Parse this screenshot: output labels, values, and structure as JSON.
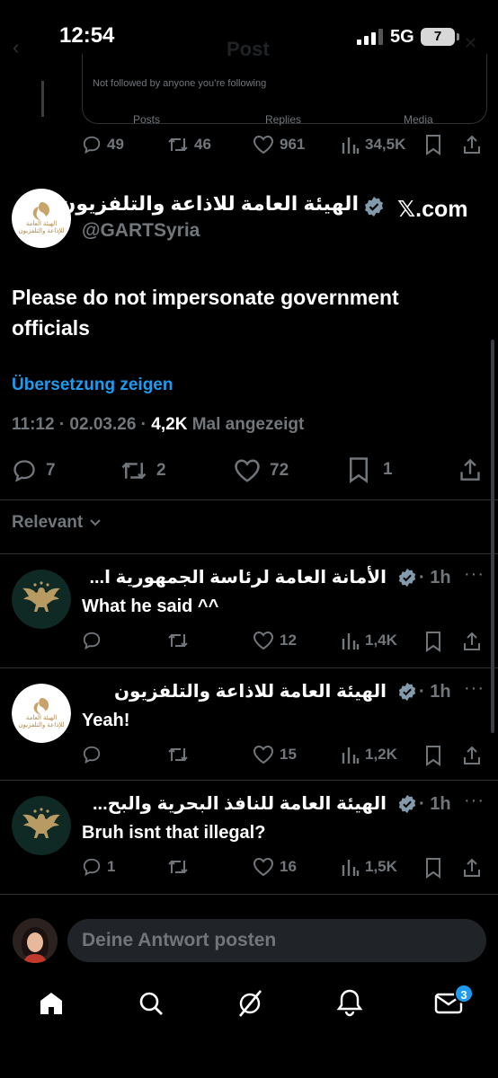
{
  "status_bar": {
    "time": "12:54",
    "network": "5G",
    "battery": "7"
  },
  "header": {
    "back_glyph": "‹",
    "title": "Post",
    "more_glyph": "✕"
  },
  "top_card": {
    "text": "Not followed by anyone you’re following",
    "tabs": [
      "Posts",
      "Replies",
      "Media"
    ],
    "actions": {
      "replies": "49",
      "reposts": "46",
      "likes": "961",
      "views": "34,5K"
    }
  },
  "post": {
    "author": "الهيئة العامة للاذاعة والتلفزيون",
    "handle": "@GARTSyria",
    "watermark": "𝕏.com",
    "avatar_logo_text": "الهيئة العامة للإذاعة والتلفزيون",
    "text": "Please do not impersonate government officials",
    "translate_label": "Übersetzung zeigen",
    "time": "11:12 · 02.03.26 ·",
    "views_count": "4,2K",
    "views_label": "Mal angezeigt",
    "actions": {
      "replies": "7",
      "reposts": "2",
      "likes": "72",
      "bookmarks": "1"
    }
  },
  "sort": {
    "label": "Relevant"
  },
  "replies": [
    {
      "author": "الأمانة العامة لرئاسة الجمهورية ا...",
      "time": "· 1h",
      "text": "What he said ^^",
      "replies": "",
      "likes": "12",
      "views": "1,4K",
      "avatar": "eagle"
    },
    {
      "author": "الهيئة العامة للاذاعة والتلفزيون",
      "time": "· 1h",
      "text": "Yeah!",
      "replies": "",
      "likes": "15",
      "views": "1,2K",
      "avatar": "gart"
    },
    {
      "author": "الهيئة العامة للنافذ البحرية والبح...",
      "time": "· 1h",
      "text": "Bruh isnt that illegal?",
      "replies": "1",
      "likes": "16",
      "views": "1,5K",
      "avatar": "eagle"
    }
  ],
  "composer": {
    "placeholder": "Deine Antwort posten"
  },
  "tabbar": {
    "notifications_badge": "3"
  },
  "colors": {
    "accent": "#1d9bf0",
    "muted": "#71767b",
    "verified": "#829aab",
    "eagle_gold": "#b89a63",
    "eagle_bg": "#0f2a24"
  }
}
